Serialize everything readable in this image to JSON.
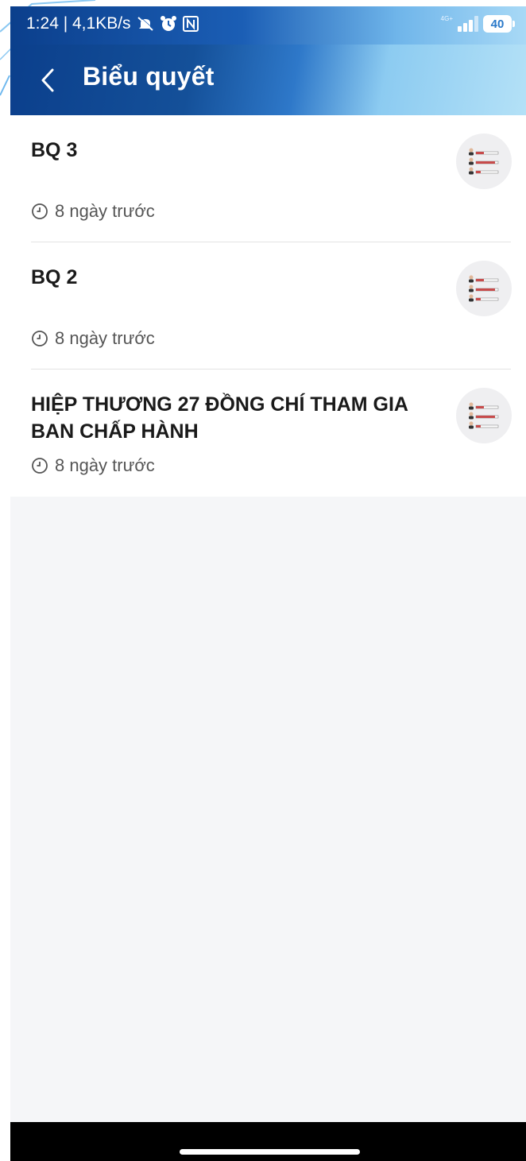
{
  "status_bar": {
    "time_speed": "1:24 | 4,1KB/s",
    "network_label": "4G+",
    "battery": "40"
  },
  "header": {
    "title": "Biểu quyết"
  },
  "items": [
    {
      "title": "BQ 3",
      "time": "8 ngày trước"
    },
    {
      "title": "BQ 2",
      "time": "8 ngày trước"
    },
    {
      "title": "HIỆP THƯƠNG 27 ĐỒNG CHÍ THAM GIA BAN CHẤP HÀNH",
      "time": "8 ngày trước"
    }
  ],
  "icons": {
    "back": "chevron-left-icon",
    "clock": "clock-icon",
    "vote": "vote-list-icon"
  },
  "colors": {
    "header_dark": "#0b3f8c",
    "header_light": "#b4e1f7",
    "background": "#f5f6f8",
    "accent_red": "#c74b4b"
  }
}
